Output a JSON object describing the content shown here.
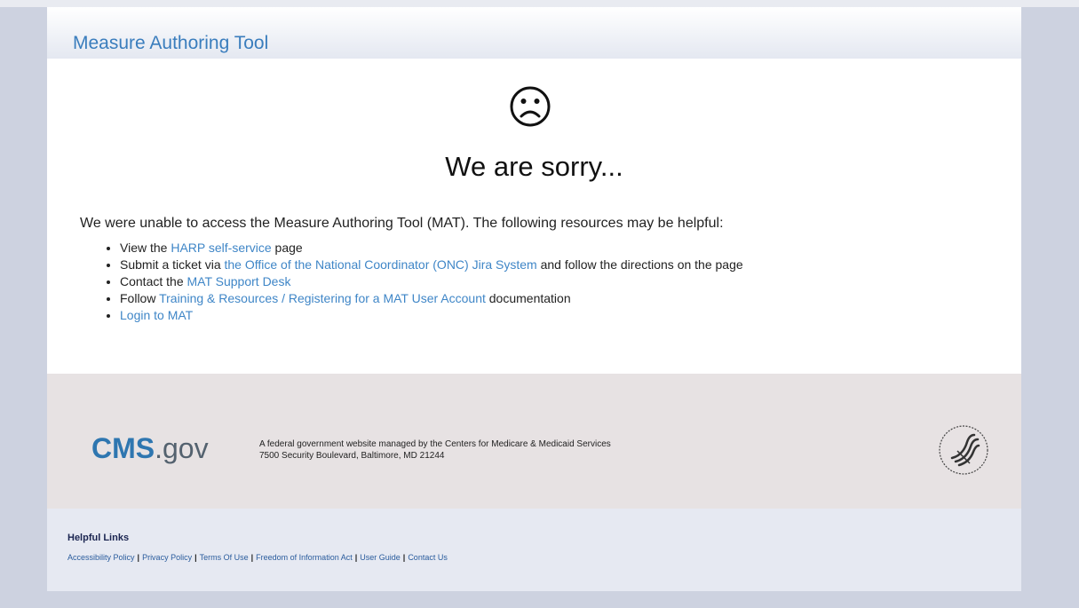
{
  "header": {
    "title": "Measure Authoring Tool"
  },
  "icons": {
    "sad_face": "frowning-face-icon",
    "seal": "hhs-seal-icon"
  },
  "main": {
    "heading": "We are sorry...",
    "intro": "We were unable to access the Measure Authoring Tool (MAT). The following resources may be helpful:",
    "items": [
      {
        "before": "View the ",
        "link": "HARP self-service",
        "after": " page"
      },
      {
        "before": "Submit a ticket via ",
        "link": "the Office of the National Coordinator (ONC) Jira System",
        "after": " and follow the directions on the page"
      },
      {
        "before": "Contact the ",
        "link": "MAT Support Desk",
        "after": ""
      },
      {
        "before": "Follow ",
        "link": "Training & Resources / Registering for a MAT User Account",
        "after": " documentation"
      },
      {
        "before": "",
        "link": "Login to MAT",
        "after": ""
      }
    ]
  },
  "cms_footer": {
    "logo_cms": "CMS",
    "logo_gov": ".gov",
    "line1": "A federal government website managed by the Centers for Medicare & Medicaid Services",
    "line2": "7500 Security Boulevard, Baltimore, MD 21244"
  },
  "helpful_links": {
    "title": "Helpful Links",
    "separator": "|",
    "links": [
      "Accessibility Policy",
      "Privacy Policy",
      "Terms Of Use",
      "Freedom of Information Act",
      "User Guide",
      "Contact Us"
    ]
  },
  "colors": {
    "link": "#3f86c7",
    "title": "#3a7dbd",
    "cms_blue": "#2e76b0",
    "page_bg": "#cdd2e0"
  }
}
